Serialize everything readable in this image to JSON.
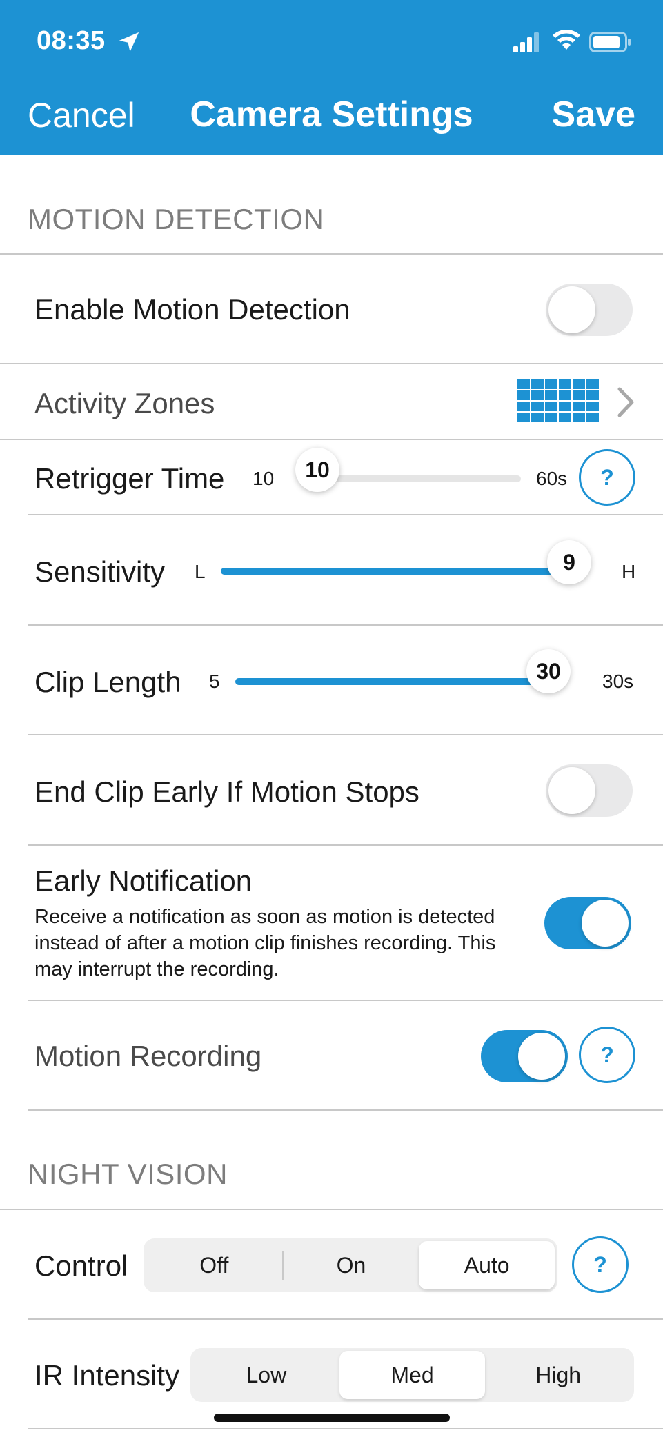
{
  "status_bar": {
    "time": "08:35"
  },
  "nav": {
    "cancel": "Cancel",
    "title": "Camera Settings",
    "save": "Save"
  },
  "motion_section": {
    "header": "MOTION DETECTION",
    "enable_motion": {
      "label": "Enable Motion Detection",
      "on": false
    },
    "activity_zones": {
      "label": "Activity Zones"
    },
    "retrigger": {
      "label": "Retrigger Time",
      "min": "10",
      "max": "60s",
      "value": "10",
      "value_fraction": 0.0
    },
    "sensitivity": {
      "label": "Sensitivity",
      "min": "L",
      "max": "H",
      "value": "9",
      "value_fraction": 1.0
    },
    "clip_length": {
      "label": "Clip Length",
      "min": "5",
      "max": "30s",
      "value": "30",
      "value_fraction": 1.0
    },
    "end_clip_early": {
      "label": "End Clip Early If Motion Stops",
      "on": false
    },
    "early_notification": {
      "label": "Early Notification",
      "description": "Receive a notification as soon as motion is detected instead of after a motion clip finishes recording. This may interrupt the recording.",
      "on": true
    },
    "motion_recording": {
      "label": "Motion Recording",
      "on": true
    },
    "help_glyph": "?"
  },
  "night_section": {
    "header": "NIGHT VISION",
    "control": {
      "label": "Control",
      "options": [
        "Off",
        "On",
        "Auto"
      ],
      "selected": "Auto"
    },
    "ir_intensity": {
      "label": "IR Intensity",
      "options": [
        "Low",
        "Med",
        "High"
      ],
      "selected": "Med"
    }
  },
  "colors": {
    "accent": "#1d92d3",
    "toggle_off": "#e9e9ea",
    "section_text": "#7d7d7d"
  },
  "icons": [
    "location-arrow-icon",
    "cellular-signal-icon",
    "wifi-icon",
    "battery-icon",
    "activity-grid-icon",
    "chevron-right-icon",
    "help-icon"
  ]
}
